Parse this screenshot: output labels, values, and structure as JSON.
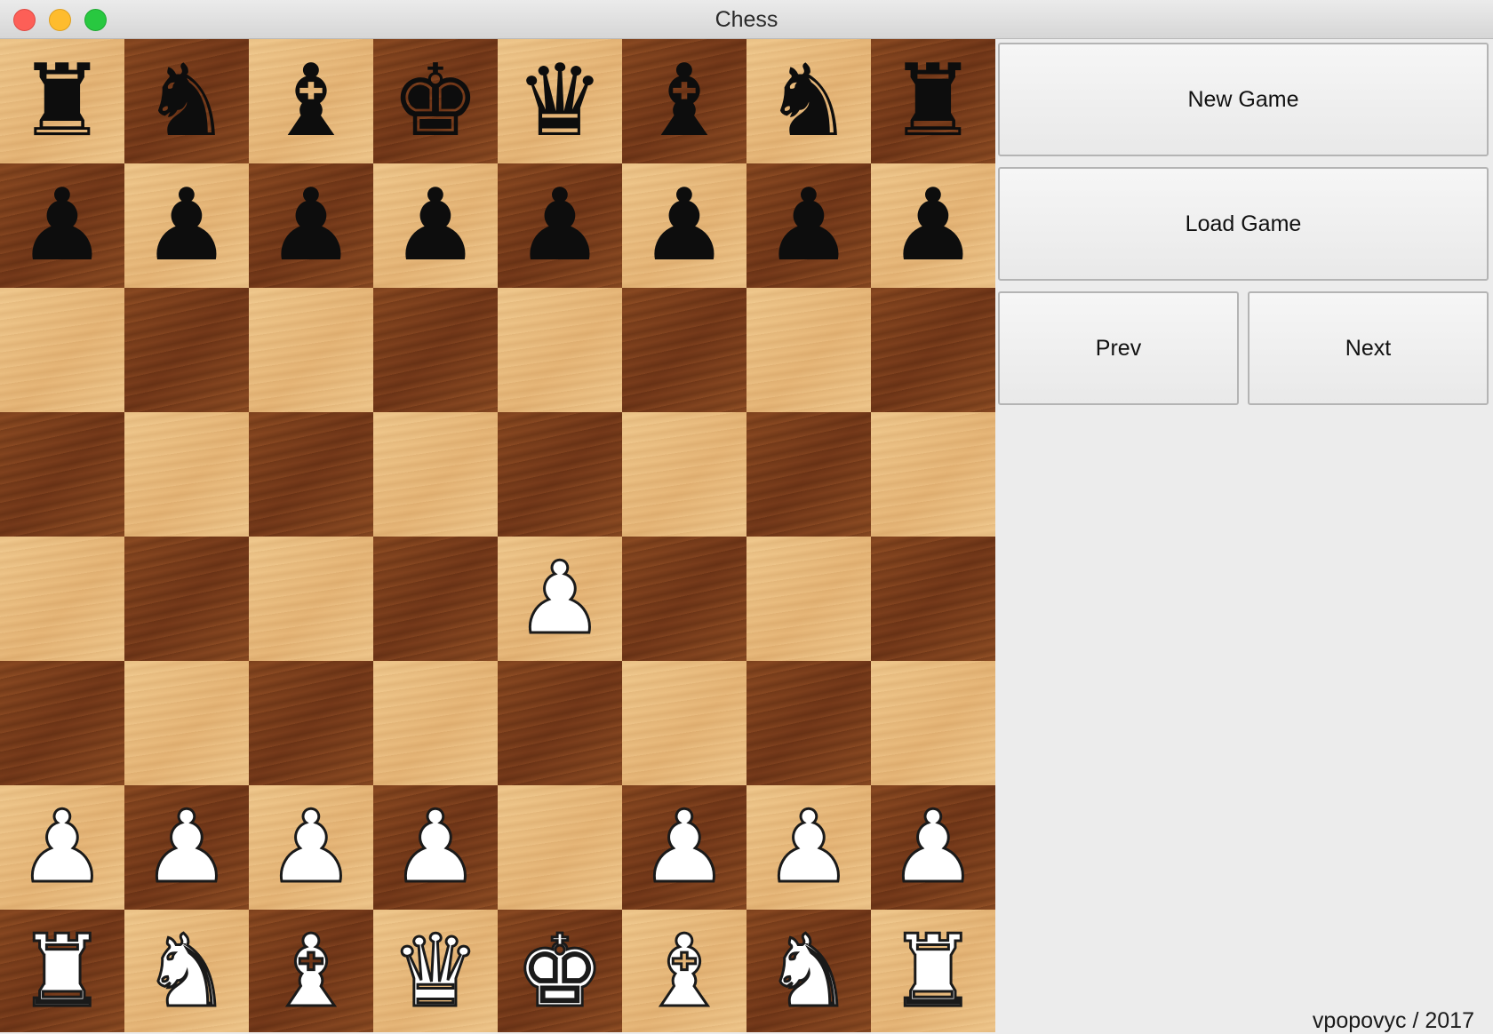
{
  "window": {
    "title": "Chess"
  },
  "controls": {
    "new_game": "New Game",
    "load_game": "Load Game",
    "prev": "Prev",
    "next": "Next"
  },
  "footer": {
    "credit": "vpopovyc / 2017"
  },
  "board": {
    "orientation": "black-top",
    "position_fen": "rnbkqbnr/pppppppp/8/8/4P3/8/PPPP1PPP/RNBQKBNR",
    "ranks": [
      [
        "r",
        "n",
        "b",
        "k",
        "q",
        "b",
        "n",
        "r"
      ],
      [
        "p",
        "p",
        "p",
        "p",
        "p",
        "p",
        "p",
        "p"
      ],
      [
        "",
        "",
        "",
        "",
        "",
        "",
        "",
        ""
      ],
      [
        "",
        "",
        "",
        "",
        "",
        "",
        "",
        ""
      ],
      [
        "",
        "",
        "",
        "",
        "P",
        "",
        "",
        ""
      ],
      [
        "",
        "",
        "",
        "",
        "",
        "",
        "",
        ""
      ],
      [
        "P",
        "P",
        "P",
        "P",
        "",
        "P",
        "P",
        "P"
      ],
      [
        "R",
        "N",
        "B",
        "Q",
        "K",
        "B",
        "N",
        "R"
      ]
    ]
  },
  "piece_names": {
    "r": "black-rook",
    "n": "black-knight",
    "b": "black-bishop",
    "q": "black-queen",
    "k": "black-king",
    "p": "black-pawn",
    "R": "white-rook",
    "N": "white-knight",
    "B": "white-bishop",
    "Q": "white-queen",
    "K": "white-king",
    "P": "white-pawn"
  },
  "colors": {
    "light_square": "#e9bb7d",
    "dark_square": "#80421e",
    "panel": "#ececec"
  }
}
